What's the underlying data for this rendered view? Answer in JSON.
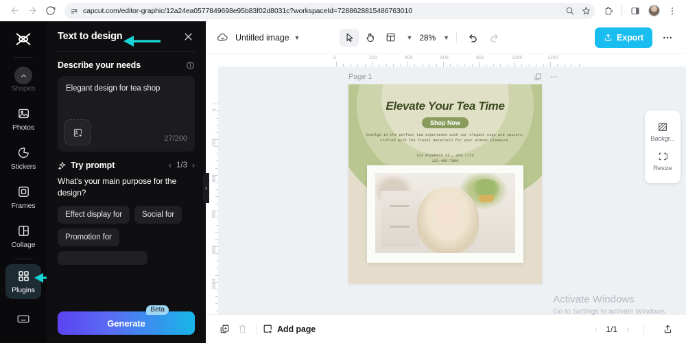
{
  "browser": {
    "url": "capcut.com/editor-graphic/12a24ea0577849698e95b83f02d8031c?workspaceId=7288628815486763010",
    "back_icon": "back-arrow-icon",
    "forward_icon": "forward-arrow-icon",
    "reload_icon": "reload-icon",
    "site_info_icon": "site-settings-icon",
    "zoom_icon": "search-zoom-icon",
    "bookmark_icon": "star-icon",
    "extensions_icon": "puzzle-icon",
    "sidepanel_icon": "side-panel-icon",
    "profile_icon": "profile-avatar",
    "menu_icon": "three-dot-menu-icon"
  },
  "rail": {
    "logo": "capcut-logo",
    "scroll_up_icon": "chevron-up-icon",
    "items": [
      {
        "label": "Shapes",
        "icon": "shapes-icon",
        "state": "dim"
      },
      {
        "label": "Photos",
        "icon": "photo-icon",
        "state": "normal"
      },
      {
        "label": "Stickers",
        "icon": "sticker-icon",
        "state": "normal"
      },
      {
        "label": "Frames",
        "icon": "frame-icon",
        "state": "normal"
      },
      {
        "label": "Collage",
        "icon": "collage-icon",
        "state": "normal"
      },
      {
        "label": "Plugins",
        "icon": "plugins-grid-icon",
        "state": "active"
      }
    ],
    "bottom_icon": "keyboard-shortcuts-icon"
  },
  "panel": {
    "title": "Text to design",
    "close_icon": "close-icon",
    "section_title": "Describe your needs",
    "info_icon": "info-icon",
    "prompt_value": "Elegant design for tea shop",
    "prompt_placeholder": "Describe your needs",
    "upload_icon": "add-image-icon",
    "char_count": "27/200",
    "try_prompt_label": "Try prompt",
    "sparkle_icon": "sparkle-icon",
    "pager_prev_icon": "chevron-left-icon",
    "pager_next_icon": "chevron-right-icon",
    "pager_text": "1/3",
    "question": "What's your main purpose for the design?",
    "chips": [
      "Effect display for",
      "Social for",
      "Promotion for"
    ],
    "generate_label": "Generate",
    "beta_label": "Beta",
    "collapse_icon": "chevron-left-icon"
  },
  "editor": {
    "cloud_icon": "cloud-save-icon",
    "doc_name": "Untitled image",
    "doc_chevron_icon": "chevron-down-icon",
    "tools": [
      {
        "name": "select-tool",
        "icon": "cursor-icon",
        "state": "on"
      },
      {
        "name": "hand-tool",
        "icon": "hand-icon",
        "state": "normal"
      },
      {
        "name": "layout-tool",
        "icon": "layout-grid-icon",
        "state": "normal"
      }
    ],
    "layout_chevron_icon": "chevron-down-icon",
    "zoom_level": "28%",
    "zoom_chevron_icon": "chevron-down-icon",
    "undo_icon": "undo-icon",
    "redo_icon": "redo-icon",
    "export_label": "Export",
    "export_icon": "upload-icon",
    "more_icon": "three-dot-menu-icon",
    "page_label": "Page 1",
    "page_duplicate_icon": "duplicate-page-icon",
    "page_more_icon": "three-dot-menu-icon",
    "ruler_h_ticks": [
      "0",
      "200",
      "400",
      "600",
      "800",
      "1000",
      "1200"
    ],
    "ruler_v_ticks": [
      "0",
      "200",
      "400",
      "600",
      "800",
      "1000",
      "1200"
    ],
    "side_tools": [
      {
        "label": "Backgr...",
        "icon": "background-icon"
      },
      {
        "label": "Resize",
        "icon": "resize-icon"
      }
    ],
    "bottom": {
      "duplicate_icon": "duplicate-icon",
      "delete_icon": "trash-icon",
      "add_page_icon": "add-page-icon",
      "add_page_label": "Add page",
      "prev_page_icon": "chevron-left-icon",
      "page_indicator": "1/1",
      "next_page_icon": "chevron-right-icon",
      "export_icon": "upload-icon"
    }
  },
  "canvas": {
    "title": "Elevate Your Tea Time",
    "cta": "Shop Now",
    "body": "Indulge in the perfect tea experience with our elegant cups and saucers, crafted with the finest materials for your utmost pleasure.",
    "address": "123 Anywhere St., Any City",
    "phone": "123-456-7890",
    "photo_alt": "portrait-photo"
  },
  "watermark": {
    "line1": "Activate Windows",
    "line2": "Go to Settings to activate Windows."
  },
  "colors": {
    "accent_cyan": "#19bdef",
    "generate_gradient_start": "#5b43f2",
    "generate_gradient_end": "#17b6e8",
    "annotation_teal": "#18d4d4",
    "canvas_bg": "#e4ddcb",
    "canvas_olive": "#b9c68f",
    "canvas_title": "#3c4a20"
  }
}
